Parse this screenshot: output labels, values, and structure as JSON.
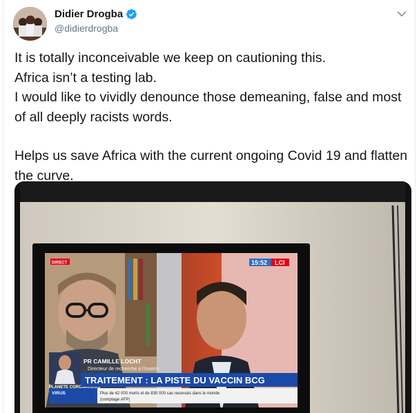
{
  "author": {
    "name": "Didier Drogba",
    "handle": "@didierdrogba",
    "verified": true,
    "avatar_icon": "profile-photo"
  },
  "menu_icon": "chevron-down-icon",
  "tweet": {
    "lines": [
      "It is totally inconceivable we keep on cautioning this.",
      "Africa isn’t a testing lab.",
      "I would like to vividly denounce those demeaning, false and most of all deeply racists words.",
      "",
      "Helps us save Africa with the current ongoing Covid 19 and flatten the curve."
    ]
  },
  "video": {
    "tv_badge_direct": "DIRECT",
    "tv_time": "15:52",
    "tv_channel": "LCI",
    "tv_lower_name": "PR CAMILLE LOCHT",
    "tv_lower_role": "Directeur de recherche à l'Inserm",
    "tv_headline": "TRAITEMENT : LA PISTE DU VACCIN BCG",
    "tv_side_label": "VIRUS",
    "tv_ticker": "Plus de 42 000 morts et de 830 000 cas recensés dans le monde",
    "tv_ticker_source": "(comptage AFP)",
    "tv_small_label": "PLANETE CORONAVIRUS"
  },
  "colors": {
    "verified_blue": "#1da1f2",
    "secondary_text": "#657786",
    "lci_red": "#e1001a",
    "headline_blue": "#1b4aa8"
  }
}
